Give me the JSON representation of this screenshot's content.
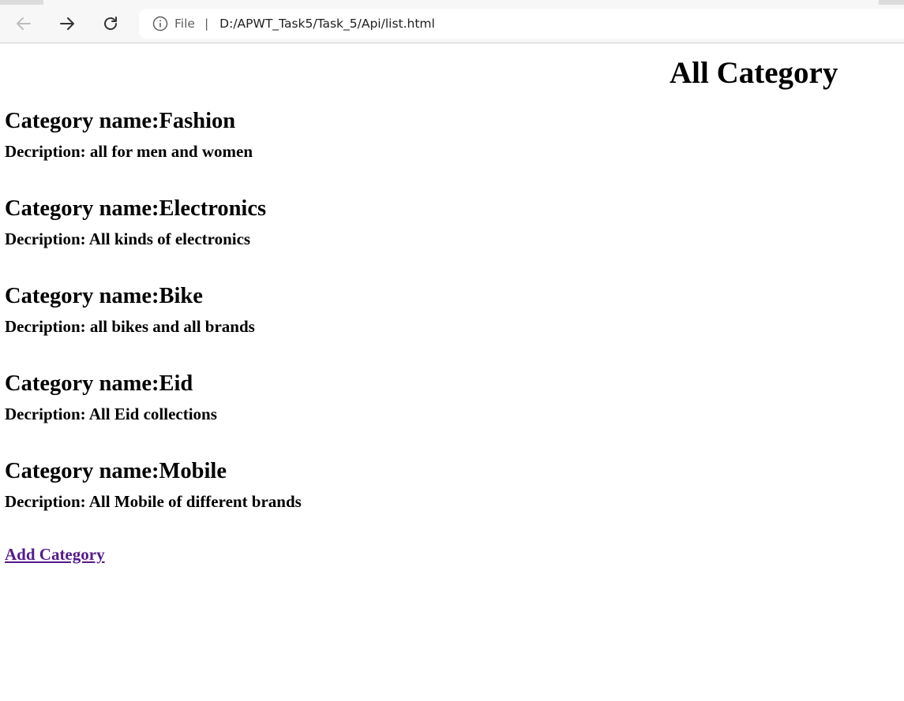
{
  "browser": {
    "scheme_label": "File",
    "separator": "|",
    "url": "D:/APWT_Task5/Task_5/Api/list.html"
  },
  "page": {
    "title": "All Category",
    "name_prefix": "Category name:",
    "desc_prefix": "Decription: ",
    "categories": [
      {
        "name": "Fashion",
        "description": "all for men and women"
      },
      {
        "name": "Electronics",
        "description": "All kinds of electronics"
      },
      {
        "name": "Bike",
        "description": "all bikes and all brands"
      },
      {
        "name": "Eid",
        "description": "All Eid collections"
      },
      {
        "name": "Mobile",
        "description": "All Mobile of different brands"
      }
    ],
    "add_link_label": "Add Category"
  },
  "colors": {
    "link_visited": "#551a8b",
    "toolbar_bg": "#f7f7f7"
  }
}
